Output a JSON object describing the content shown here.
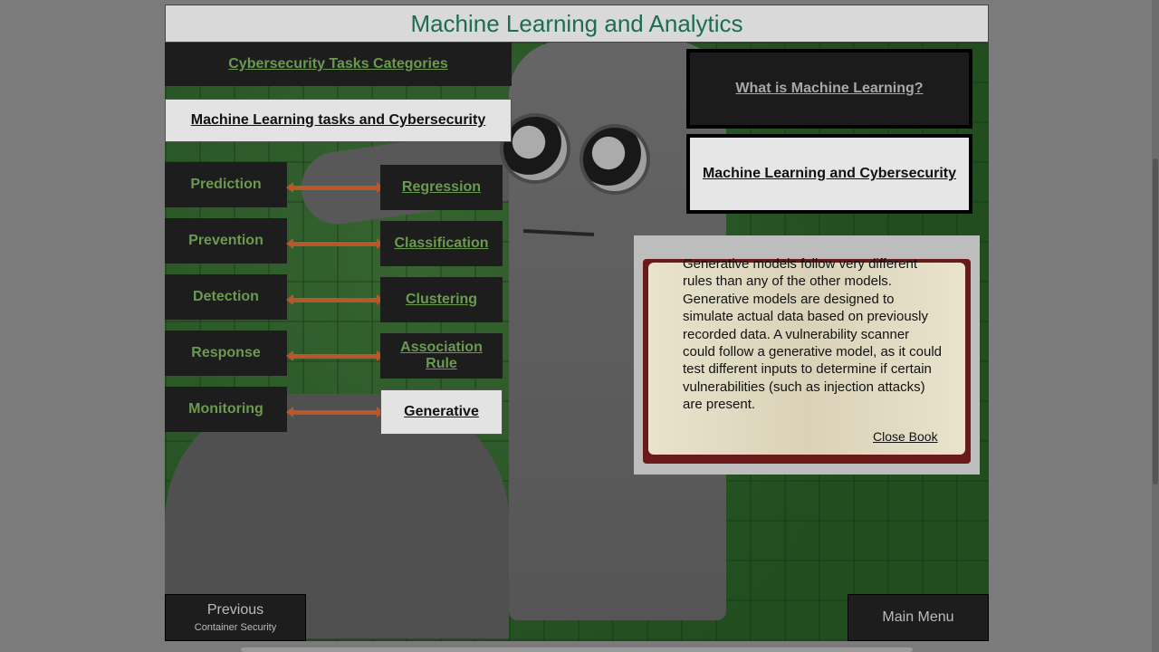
{
  "header": {
    "title": "Machine Learning and Analytics"
  },
  "tabs": {
    "categories": "Cybersecurity Tasks Categories",
    "ml_tasks": "Machine Learning tasks and Cybersecurity"
  },
  "tasks": [
    {
      "label": "Prediction"
    },
    {
      "label": "Prevention"
    },
    {
      "label": "Detection"
    },
    {
      "label": "Response"
    },
    {
      "label": "Monitoring"
    }
  ],
  "ml_types": [
    {
      "label": "Regression"
    },
    {
      "label": "Classification"
    },
    {
      "label": "Clustering"
    },
    {
      "label": "Association Rule"
    },
    {
      "label": "Generative"
    }
  ],
  "right_buttons": {
    "what_is": "What is Machine Learning?",
    "ml_cyber": "Machine Learning and Cybersecurity"
  },
  "book": {
    "text": "Generative models follow very different rules than any of the other models. Generative models are designed to simulate actual data based on previously recorded data. A vulnerability scanner could follow a generative model, as it could test different inputs to determine if certain vulnerabilities (such as injection attacks) are present.",
    "close_label": "Close Book"
  },
  "nav": {
    "previous_label": "Previous",
    "previous_sub": "Container Security",
    "main_menu": "Main Menu"
  },
  "colors": {
    "accent_green": "#6a9a50",
    "title_teal": "#1c6d52",
    "arrow_orange": "#b8572a"
  }
}
